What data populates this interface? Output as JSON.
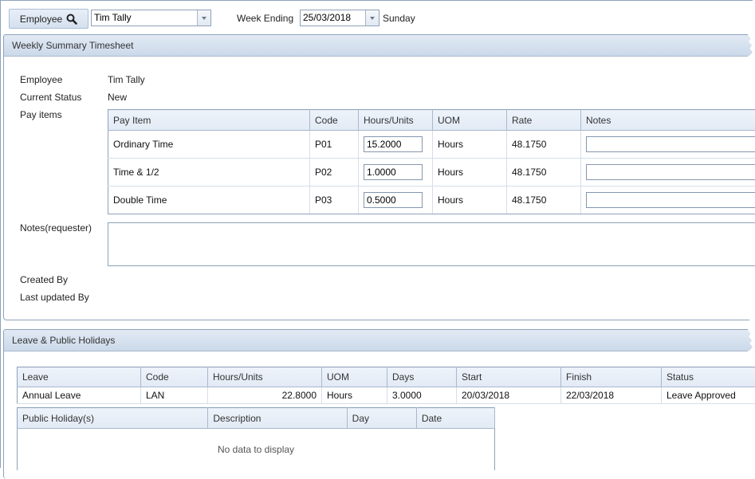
{
  "toolbar": {
    "employee_button": "Employee",
    "employee_value": "Tim Tally",
    "week_ending_label": "Week Ending",
    "week_ending_value": "25/03/2018",
    "week_day": "Sunday"
  },
  "weekly_summary": {
    "title": "Weekly Summary Timesheet",
    "employee_label": "Employee",
    "employee_value": "Tim Tally",
    "status_label": "Current Status",
    "status_value": "New",
    "pay_items_label": "Pay items",
    "pay_grid": {
      "columns": [
        "Pay Item",
        "Code",
        "Hours/Units",
        "UOM",
        "Rate",
        "Notes"
      ],
      "rows": [
        {
          "pay_item": "Ordinary Time",
          "code": "P01",
          "hours": "15.2000",
          "uom": "Hours",
          "rate": "48.1750",
          "notes": ""
        },
        {
          "pay_item": "Time & 1/2",
          "code": "P02",
          "hours": "1.0000",
          "uom": "Hours",
          "rate": "48.1750",
          "notes": ""
        },
        {
          "pay_item": "Double Time",
          "code": "P03",
          "hours": "0.5000",
          "uom": "Hours",
          "rate": "48.1750",
          "notes": ""
        }
      ]
    },
    "notes_label": "Notes(requester)",
    "notes_value": "",
    "created_by_label": "Created By",
    "created_by_value": "",
    "last_updated_label": "Last updated By",
    "last_updated_value": ""
  },
  "leave": {
    "title": "Leave & Public Holidays",
    "leave_grid": {
      "columns": [
        "Leave",
        "Code",
        "Hours/Units",
        "UOM",
        "Days",
        "Start",
        "Finish",
        "Status"
      ],
      "rows": [
        {
          "leave": "Annual Leave",
          "code": "LAN",
          "hours": "22.8000",
          "uom": "Hours",
          "days": "3.0000",
          "start": "20/03/2018",
          "finish": "22/03/2018",
          "status": "Leave Approved"
        }
      ]
    },
    "holiday_grid": {
      "columns": [
        "Public Holiday(s)",
        "Description",
        "Day",
        "Date"
      ],
      "empty_text": "No data to display"
    }
  }
}
